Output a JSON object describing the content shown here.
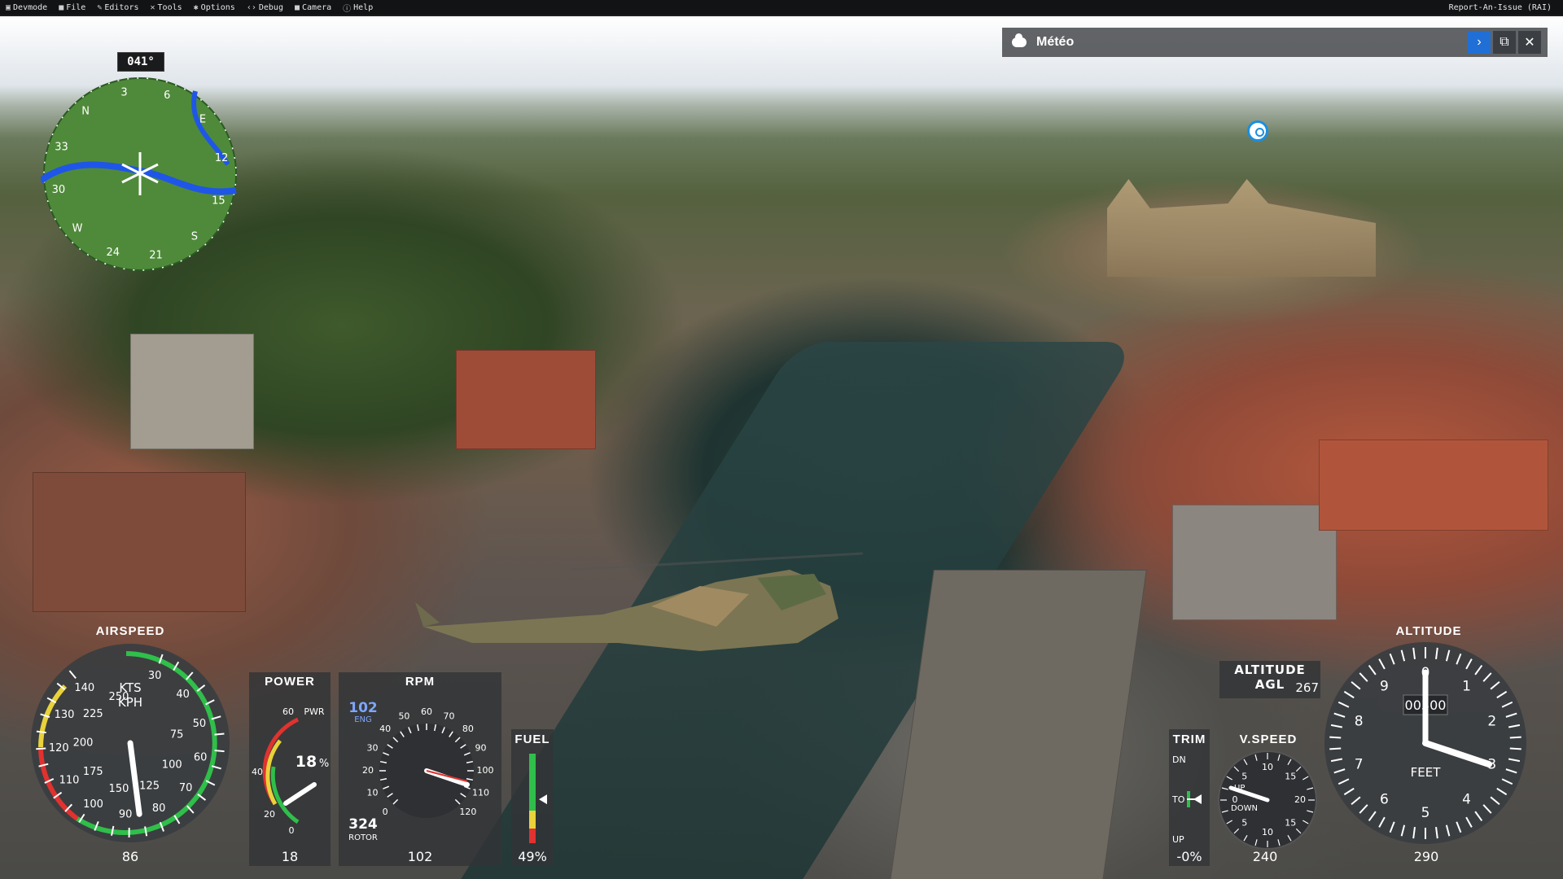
{
  "menubar": {
    "items": [
      {
        "label": "Devmode",
        "icon": "devmode-icon"
      },
      {
        "label": "File",
        "icon": "folder-icon"
      },
      {
        "label": "Editors",
        "icon": "pencil-icon"
      },
      {
        "label": "Tools",
        "icon": "tools-icon"
      },
      {
        "label": "Options",
        "icon": "gear-icon"
      },
      {
        "label": "Debug",
        "icon": "code-icon"
      },
      {
        "label": "Camera",
        "icon": "camera-icon"
      },
      {
        "label": "Help",
        "icon": "help-icon"
      }
    ],
    "report": "Report-An-Issue (RAI)"
  },
  "meteo": {
    "title": "Météo"
  },
  "heading": {
    "value": "041°"
  },
  "compass": {
    "labels": [
      "N",
      "3",
      "6",
      "E",
      "12",
      "15",
      "S",
      "21",
      "24",
      "W",
      "30",
      "33"
    ]
  },
  "airspeed": {
    "label": "AIRSPEED",
    "units_kts": "KTS",
    "units_kph": "KPH",
    "value": "86",
    "kts_ticks": [
      "30",
      "40",
      "50",
      "60",
      "70",
      "80",
      "90",
      "100",
      "110",
      "120",
      "130",
      "140"
    ],
    "kph_ticks": [
      "75",
      "100",
      "125",
      "150",
      "175",
      "200",
      "225",
      "250"
    ]
  },
  "power": {
    "label": "POWER",
    "pwr_label": "PWR",
    "percent": "18",
    "percent_sign": "%",
    "value": "18",
    "ticks": [
      "0",
      "20",
      "40",
      "60"
    ]
  },
  "rpm": {
    "label": "RPM",
    "eng_value": "102",
    "eng_label": "ENG",
    "rotor_value": "324",
    "rotor_label": "ROTOR",
    "value": "102",
    "ticks": [
      "0",
      "10",
      "20",
      "30",
      "40",
      "50",
      "60",
      "70",
      "80",
      "90",
      "100",
      "110",
      "120"
    ]
  },
  "fuel": {
    "label": "FUEL",
    "value": "49%",
    "level": 0.49
  },
  "trim": {
    "label": "TRIM",
    "dn": "DN",
    "to": "TO",
    "up": "UP",
    "value": "-0%"
  },
  "vspeed": {
    "label": "V.SPEED",
    "up": "UP",
    "down": "DOWN",
    "value": "240",
    "ticks": [
      "0",
      "5",
      "10",
      "15",
      "20",
      "15",
      "10",
      "5"
    ]
  },
  "altitude_agl": {
    "label": "ALTITUDE AGL",
    "value": "267"
  },
  "altitude": {
    "label": "ALTITUDE",
    "drum": "00300",
    "feet": "FEET",
    "value": "290",
    "ticks": [
      "0",
      "1",
      "2",
      "3",
      "4",
      "5",
      "6",
      "7",
      "8",
      "9"
    ]
  },
  "colors": {
    "green": "#2fbf4a",
    "yellow": "#e9d23a",
    "red": "#e0322f",
    "blue": "#1f6fd6"
  }
}
